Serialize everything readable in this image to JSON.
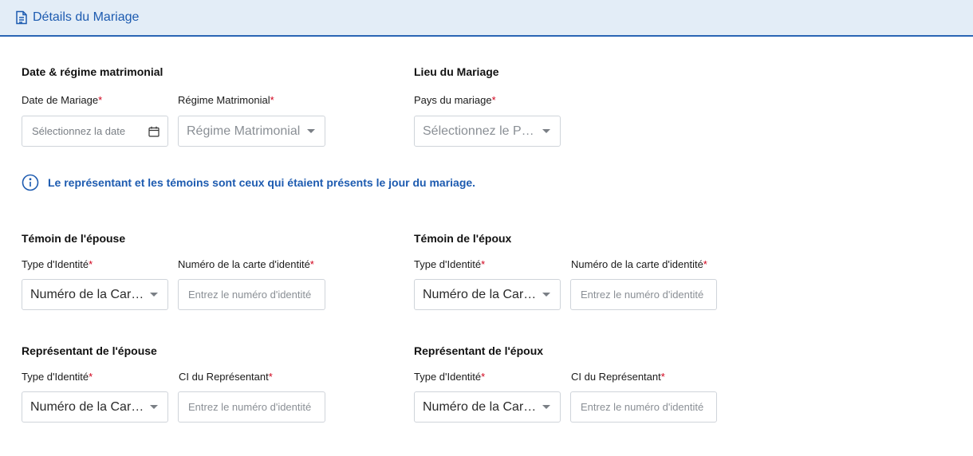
{
  "header": {
    "title": "Détails du Mariage",
    "icon": "document-icon"
  },
  "colors": {
    "accent": "#1d5bb0",
    "required": "#d0021b",
    "header_bg": "#e3edf7"
  },
  "date_section": {
    "title": "Date & régime matrimonial",
    "date_label": "Date de Mariage",
    "date_placeholder": "Sélectionnez la date",
    "regime_label": "Régime Matrimonial",
    "regime_placeholder": "Régime Matrimonial"
  },
  "lieu_section": {
    "title": "Lieu du Mariage",
    "pays_label": "Pays du mariage",
    "pays_placeholder": "Sélectionnez le Pays"
  },
  "info": {
    "text": "Le représentant et les témoins sont ceux qui étaient présents le jour du mariage."
  },
  "required_mark": "*",
  "temoin_epouse": {
    "title": "Témoin de l'épouse",
    "type_label": "Type d'Identité",
    "type_value": "Numéro de la Carte d'Identité",
    "num_label": "Numéro de la carte d'identité",
    "num_placeholder": "Entrez le numéro d'identité"
  },
  "temoin_epoux": {
    "title": "Témoin de l'époux",
    "type_label": "Type d'Identité",
    "type_value": "Numéro de la Carte d'Identité",
    "num_label": "Numéro de la carte d'identité",
    "num_placeholder": "Entrez le numéro d'identité"
  },
  "representant_epouse": {
    "title": "Représentant de l'épouse",
    "type_label": "Type d'Identité",
    "type_value": "Numéro de la Carte d'Identité",
    "ci_label": "CI du Représentant",
    "ci_placeholder": "Entrez le numéro d'identité"
  },
  "representant_epoux": {
    "title": "Représentant de l'époux",
    "type_label": "Type d'Identité",
    "type_value": "Numéro de la Carte d'Identité",
    "ci_label": "CI du Représentant",
    "ci_placeholder": "Entrez le numéro d'identité"
  }
}
